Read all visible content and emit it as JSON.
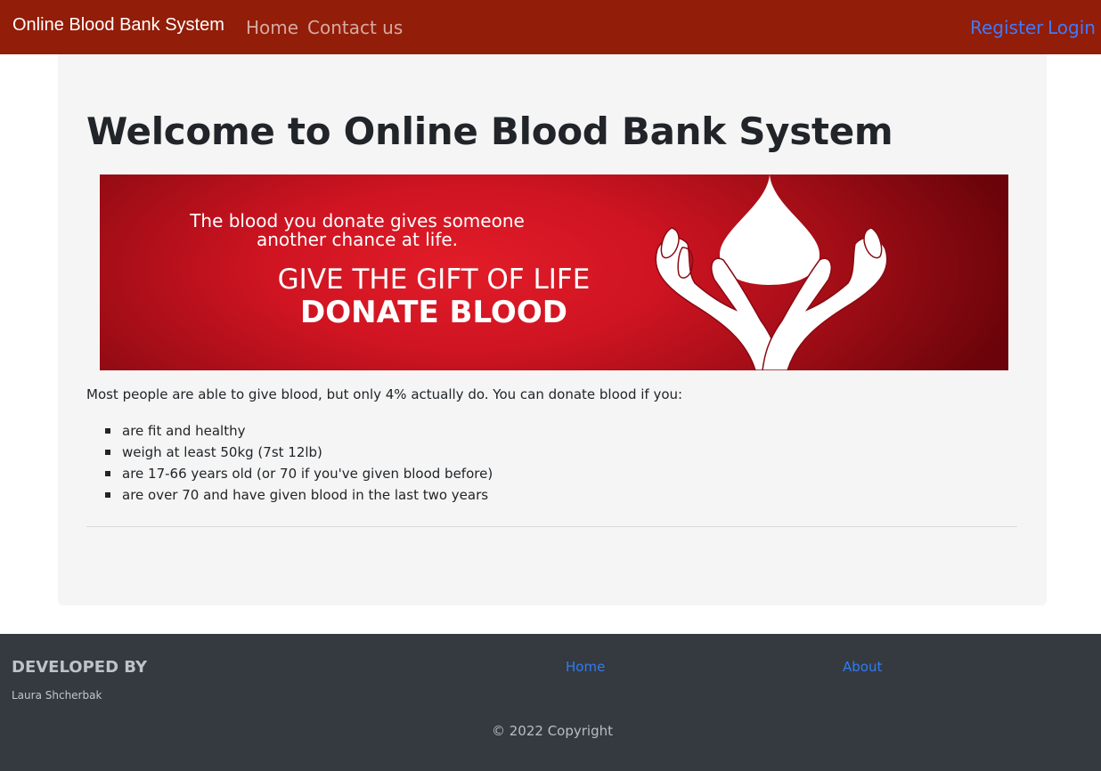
{
  "navbar": {
    "brand": "Online Blood Bank System",
    "left_links": [
      "Home",
      "Contact us"
    ],
    "right_links": [
      "Register",
      "Login"
    ],
    "background_color": "#921d08"
  },
  "main": {
    "title": "Welcome to Online Blood Bank System",
    "banner": {
      "line1": "The blood you donate gives someone",
      "line2": "another chance at life.",
      "headline": "GIVE THE GIFT OF LIFE",
      "subheadline": "DONATE BLOOD"
    },
    "intro": "Most people are able to give blood, but only 4% actually do. You can donate blood if you:",
    "requirements": [
      "are fit and healthy",
      "weigh at least 50kg (7st 12lb)",
      "are 17-66 years old (or 70 if you've given blood before)",
      "are over 70 and have given blood in the last two years"
    ]
  },
  "footer": {
    "developed_by_label": "DEVELOPED BY",
    "developer_name": "Laura Shcherbak",
    "links": [
      "Home",
      "About"
    ],
    "copyright": "© 2022 Copyright",
    "background_color": "#343a40"
  }
}
